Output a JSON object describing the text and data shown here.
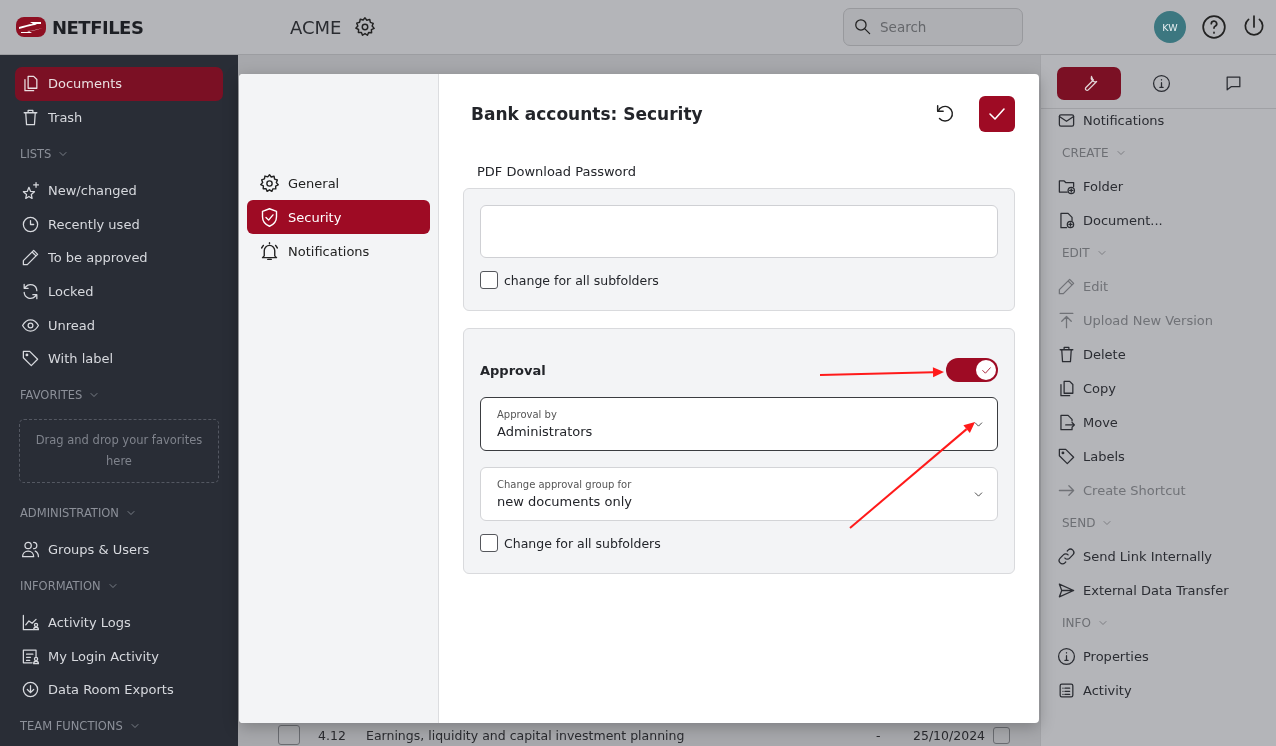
{
  "header": {
    "logo": "NETFILES",
    "workspace": "ACME",
    "search": {
      "placeholder": "Search"
    },
    "avatar": "KW"
  },
  "sidebar": {
    "sections": [
      {
        "items": [
          {
            "label": "Documents",
            "selected": true
          },
          {
            "label": "Trash",
            "selected": false
          }
        ]
      },
      {
        "title": "LISTS",
        "items": [
          {
            "label": "New/changed",
            "selected": false
          },
          {
            "label": "Recently used",
            "selected": false
          },
          {
            "label": "To be approved",
            "selected": false
          },
          {
            "label": "Locked",
            "selected": false
          },
          {
            "label": "Unread",
            "selected": false
          },
          {
            "label": "With label",
            "selected": false
          }
        ]
      },
      {
        "title": "FAVORITES",
        "dropzone": "Drag and drop your favorites here"
      },
      {
        "title": "ADMINISTRATION",
        "items": [
          {
            "label": "Groups & Users",
            "selected": false
          }
        ]
      },
      {
        "title": "INFORMATION",
        "items": [
          {
            "label": "Activity Logs",
            "selected": false
          },
          {
            "label": "My Login Activity",
            "selected": false
          },
          {
            "label": "Data Room Exports",
            "selected": false
          }
        ]
      },
      {
        "title": "TEAM FUNCTIONS"
      }
    ]
  },
  "document_list": {
    "rows": [
      {
        "selected": false,
        "checked": false,
        "number": "4.12",
        "title": "Earnings, liquidity and capital investment planning",
        "column_3": "-",
        "date": "25/10/2024"
      }
    ]
  },
  "dialog": {
    "nav": [
      {
        "label": "General",
        "selected": false
      },
      {
        "label": "Security",
        "selected": true
      },
      {
        "label": "Notifications",
        "selected": false
      }
    ],
    "title": "Bank accounts: Security",
    "password": {
      "label": "PDF Download Password",
      "subfolders": {
        "label": "change for all subfolders",
        "checked": false
      }
    },
    "approval": {
      "label": "Approval",
      "on": true,
      "approval_by": {
        "label": "Approval by",
        "value": "Administrators"
      },
      "change_group_for": {
        "label": "Change approval group for",
        "value": "new documents only"
      },
      "subfolders": {
        "label": "Change for all subfolders",
        "checked": false
      }
    }
  },
  "right_panel": {
    "tabs": [
      {
        "selected": true
      },
      {
        "selected": false
      },
      {
        "selected": false
      }
    ],
    "sections": [
      {
        "items": [
          {
            "label": "Notifications",
            "disabled": false
          }
        ]
      },
      {
        "title": "CREATE",
        "items": [
          {
            "label": "Folder",
            "disabled": false
          },
          {
            "label": "Document...",
            "disabled": false
          }
        ]
      },
      {
        "title": "EDIT",
        "items": [
          {
            "label": "Edit",
            "disabled": true
          },
          {
            "label": "Upload New Version",
            "disabled": true
          },
          {
            "label": "Delete",
            "disabled": false
          },
          {
            "label": "Copy",
            "disabled": false
          },
          {
            "label": "Move",
            "disabled": false
          },
          {
            "label": "Labels",
            "disabled": false
          },
          {
            "label": "Create Shortcut",
            "disabled": true
          }
        ]
      },
      {
        "title": "SEND",
        "items": [
          {
            "label": "Send Link Internally",
            "disabled": false
          },
          {
            "label": "External Data Transfer",
            "disabled": false
          }
        ]
      },
      {
        "title": "INFO",
        "items": [
          {
            "label": "Properties",
            "disabled": false
          },
          {
            "label": "Activity",
            "disabled": false
          }
        ]
      }
    ]
  },
  "annotations": [
    {
      "kind": "arrow"
    },
    {
      "kind": "arrow"
    }
  ]
}
